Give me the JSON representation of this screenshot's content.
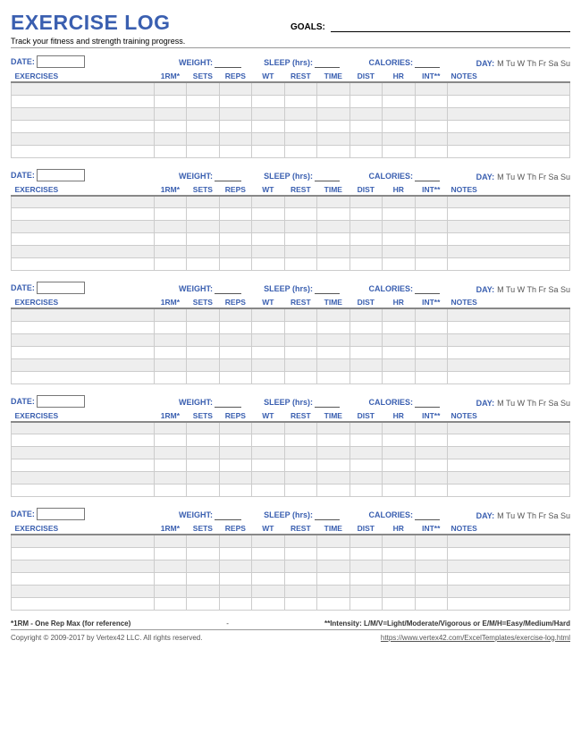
{
  "header": {
    "title": "EXERCISE LOG",
    "subtitle": "Track your fitness and strength training progress.",
    "goals_label": "GOALS:"
  },
  "block_labels": {
    "date": "DATE:",
    "weight": "WEIGHT:",
    "sleep": "SLEEP (hrs):",
    "calories": "CALORIES:",
    "day": "DAY:",
    "days_str": "M  Tu  W  Th  Fr  Sa  Su"
  },
  "columns": {
    "exercises": "EXERCISES",
    "rm": "1RM*",
    "sets": "SETS",
    "reps": "REPS",
    "wt": "WT",
    "rest": "REST",
    "time": "TIME",
    "dist": "DIST",
    "hr": "HR",
    "int": "INT**",
    "notes": "NOTES"
  },
  "num_blocks": 5,
  "rows_per_block": 6,
  "footnotes": {
    "rm": "*1RM - One Rep Max (for reference)",
    "dash": "-",
    "intensity": "**Intensity: L/M/V=Light/Moderate/Vigorous or E/M/H=Easy/Medium/Hard"
  },
  "copyright": {
    "text": "Copyright © 2009-2017 by Vertex42 LLC. All rights reserved.",
    "link": "https://www.vertex42.com/ExcelTemplates/exercise-log.html"
  }
}
